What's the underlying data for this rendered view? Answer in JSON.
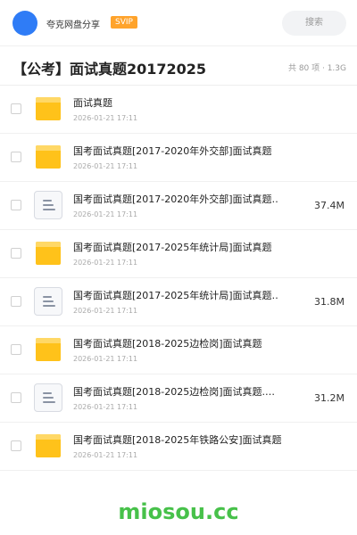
{
  "header": {
    "user_name": "夸克网盘分享",
    "badge": "SVIP",
    "search_label": "搜索",
    "accent_color": "#2f7cf6"
  },
  "folder": {
    "title": "【公考】面试真题20172025",
    "meta": "共 80 项 · 1.3G"
  },
  "files": [
    {
      "type": "folder",
      "name": "面试真题",
      "date": "2026-01-21 17:11",
      "size": ""
    },
    {
      "type": "folder",
      "name": "国考面试真题[2017-2020年外交部]面试真题",
      "date": "2026-01-21 17:11",
      "size": ""
    },
    {
      "type": "doc",
      "name": "国考面试真题[2017-2020年外交部]面试真题…",
      "date": "2026-01-21 17:11",
      "size": "37.4M"
    },
    {
      "type": "folder",
      "name": "国考面试真题[2017-2025年统计局]面试真题",
      "date": "2026-01-21 17:11",
      "size": ""
    },
    {
      "type": "doc",
      "name": "国考面试真题[2017-2025年统计局]面试真题…",
      "date": "2026-01-21 17:11",
      "size": "31.8M"
    },
    {
      "type": "folder",
      "name": "国考面试真题[2018-2025边检岗]面试真题",
      "date": "2026-01-21 17:11",
      "size": ""
    },
    {
      "type": "doc",
      "name": "国考面试真题[2018-2025边检岗]面试真题.…",
      "date": "2026-01-21 17:11",
      "size": "31.2M"
    },
    {
      "type": "folder",
      "name": "国考面试真题[2018-2025年铁路公安]面试真题",
      "date": "2026-01-21 17:11",
      "size": ""
    }
  ],
  "watermark": "miosou.cc"
}
